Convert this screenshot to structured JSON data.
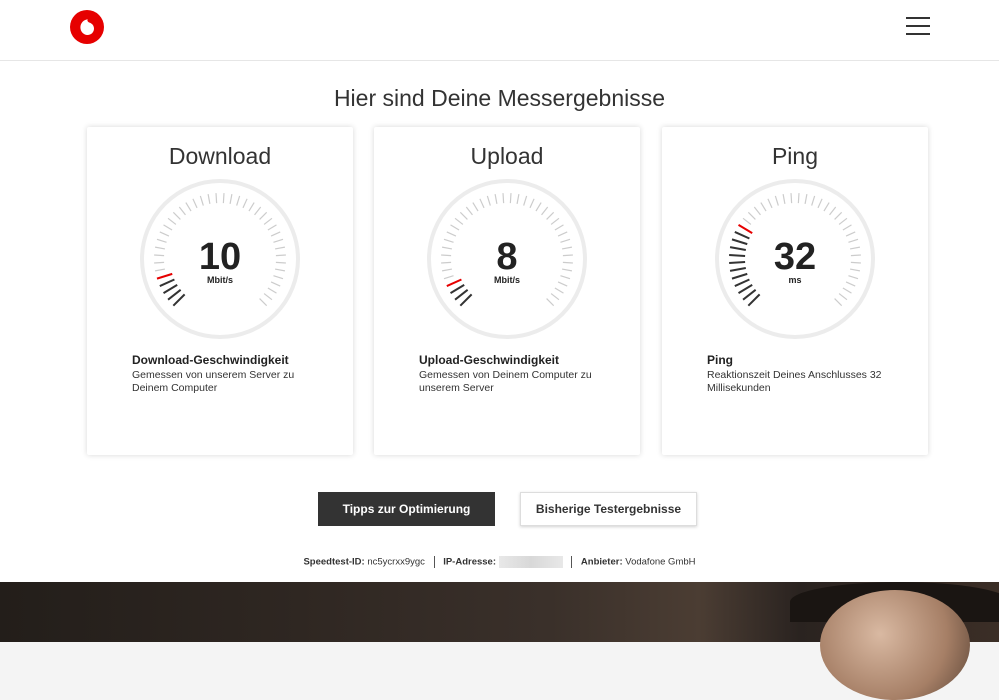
{
  "header": {
    "logo_icon": "vodafone-logo-icon",
    "menu_icon": "hamburger-menu-icon"
  },
  "main": {
    "title": "Hier sind Deine Messergebnisse"
  },
  "cards": [
    {
      "title": "Download",
      "value": "10",
      "unit": "Mbit/s",
      "label": "Download-Geschwindigkeit",
      "description": "Gemessen von unserem Server zu Deinem Computer"
    },
    {
      "title": "Upload",
      "value": "8",
      "unit": "Mbit/s",
      "label": "Upload-Geschwindigkeit",
      "description": "Gemessen von Deinem Computer zu unserem Server"
    },
    {
      "title": "Ping",
      "value": "32",
      "unit": "ms",
      "label": "Ping",
      "description": "Reaktionszeit Deines Anschlusses 32 Millisekunden"
    }
  ],
  "buttons": {
    "tips": "Tipps zur Optimierung",
    "history": "Bisherige Testergebnisse"
  },
  "info": {
    "speedtest_id_label": "Speedtest-ID:",
    "speedtest_id": "nc5ycrxx9ygc",
    "ip_label": "IP-Adresse:",
    "provider_label": "Anbieter:",
    "provider": "Vodafone GmbH"
  },
  "colors": {
    "accent": "#e60000",
    "dark_button": "#333333",
    "tick": "#333333",
    "tick_light": "#cccccc"
  },
  "gauges": [
    {
      "active_ticks": 5
    },
    {
      "active_ticks": 4
    },
    {
      "active_ticks": 12
    }
  ]
}
